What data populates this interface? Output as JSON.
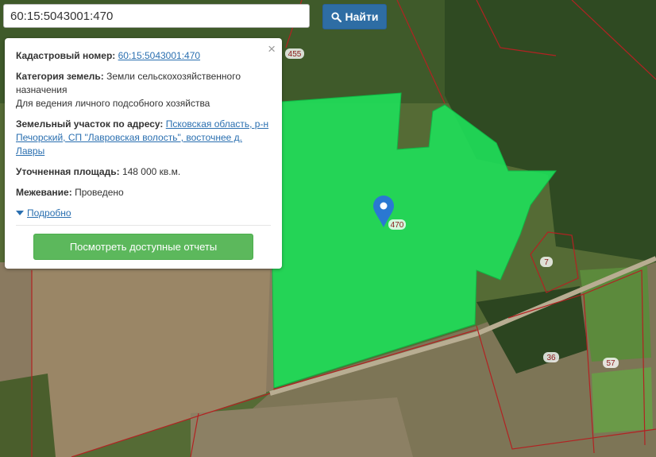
{
  "search": {
    "value": "60:15:5043001:470",
    "button_label": "Найти"
  },
  "popup": {
    "cadastral_label": "Кадастровый номер:",
    "cadastral_value": "60:15:5043001:470",
    "category_label": "Категория земель:",
    "category_value": "Земли сельскохозяйственного назначения",
    "category_use": "Для ведения личного подсобного хозяйства",
    "address_label": "Земельный участок по адресу:",
    "address_value": "Псковская область, р-н Печорский, СП \"Лавровская волость\", восточнее д. Лавры",
    "area_label": "Уточненная площадь:",
    "area_value": "148 000 кв.м.",
    "survey_label": "Межевание:",
    "survey_value": "Проведено",
    "more_link": "Подробно",
    "report_button": "Посмотреть доступные отчеты",
    "close_symbol": "×"
  },
  "map": {
    "parcel_label": "470",
    "labels": [
      "455",
      "7",
      "36",
      "57"
    ],
    "parcel_color": "#1fe05a",
    "boundary_color": "#b22222"
  }
}
